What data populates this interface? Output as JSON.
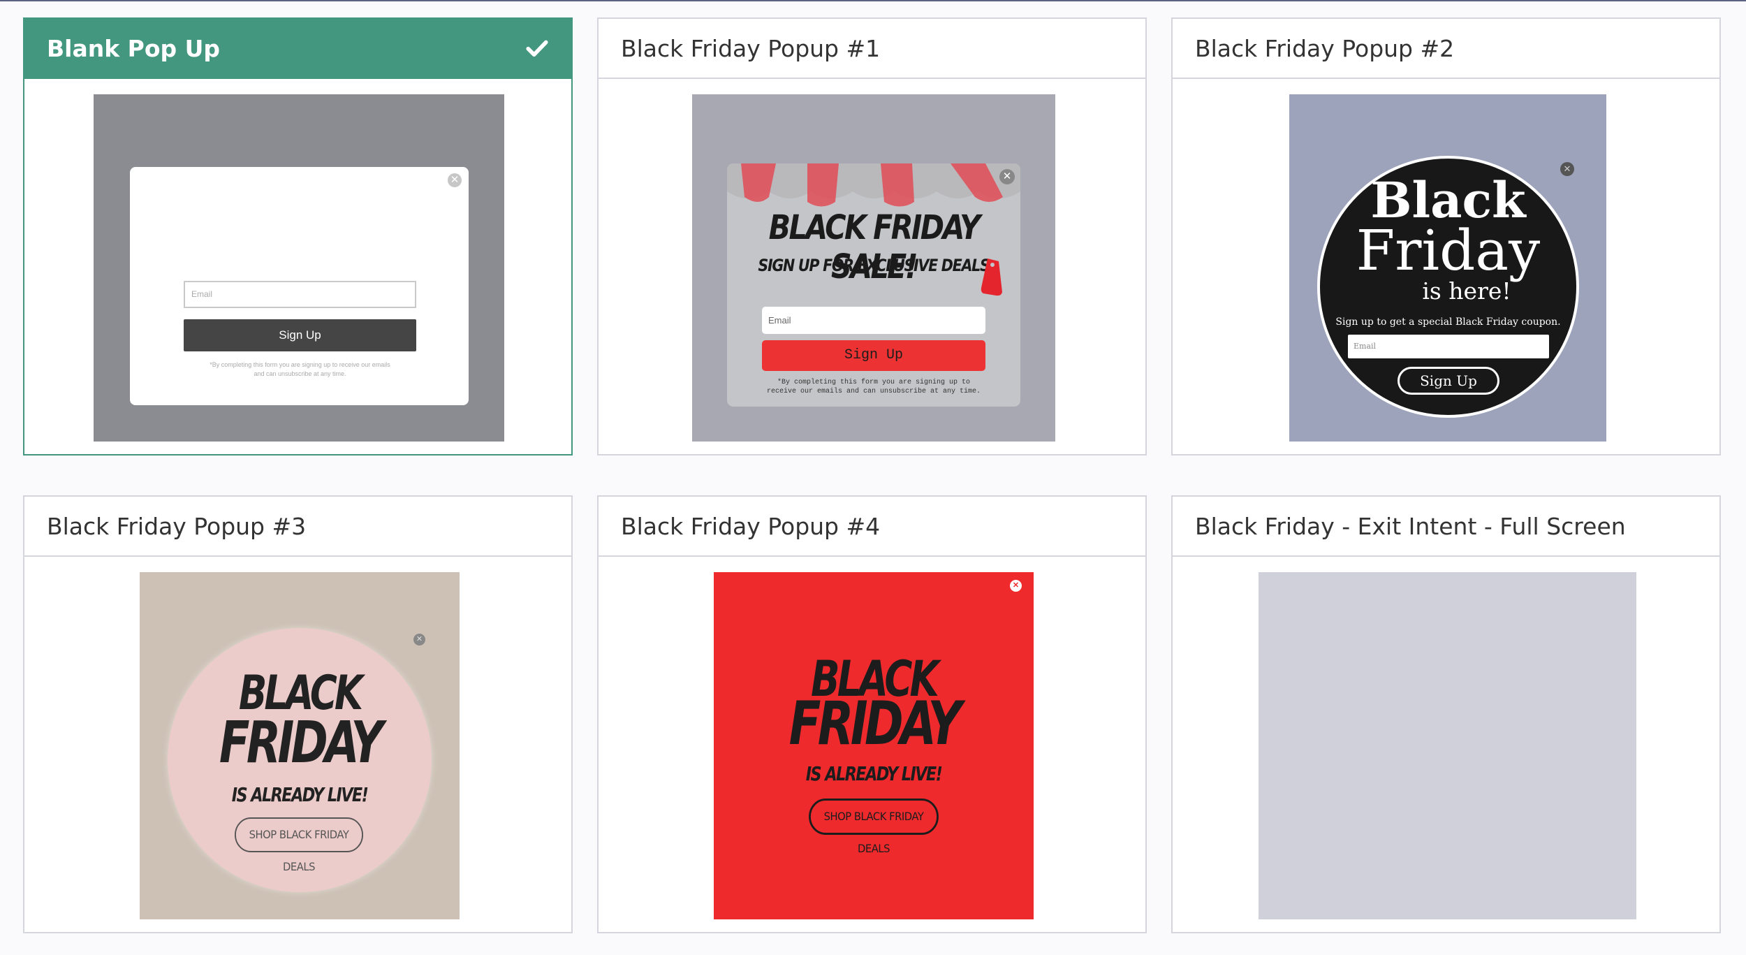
{
  "templates": [
    {
      "title": "Blank Pop Up",
      "selected": true,
      "preview": {
        "email_placeholder": "Email",
        "button": "Sign Up",
        "legal_1": "*By completing this form you are signing up to receive our emails",
        "legal_2": "and can unsubscribe at any time."
      }
    },
    {
      "title": "Black Friday Popup #1",
      "selected": false,
      "preview": {
        "headline": "BLACK FRIDAY SALE!",
        "subhead": "SIGN UP FOR EXCLUSIVE DEALS",
        "email_placeholder": "Email",
        "button": "Sign Up",
        "legal_1": "*By completing this form you are signing up to",
        "legal_2": "receive our emails and can unsubscribe at any time."
      }
    },
    {
      "title": "Black Friday Popup #2",
      "selected": false,
      "preview": {
        "line1": "Black",
        "line2": "Friday",
        "line3": "is here!",
        "subhead": "Sign up to get a special Black Friday coupon.",
        "email_placeholder": "Email",
        "button": "Sign Up"
      }
    },
    {
      "title": "Black Friday Popup #3",
      "selected": false,
      "preview": {
        "line1": "BLACK",
        "line2": "FRIDAY",
        "line3": "IS ALREADY LIVE!",
        "button": "SHOP BLACK FRIDAY DEALS"
      }
    },
    {
      "title": "Black Friday Popup #4",
      "selected": false,
      "preview": {
        "line1": "BLACK",
        "line2": "FRIDAY",
        "line3": "IS ALREADY LIVE!",
        "button": "SHOP BLACK FRIDAY DEALS"
      }
    },
    {
      "title": "Black Friday - Exit Intent - Full Screen",
      "selected": false,
      "preview": {}
    }
  ],
  "colors": {
    "selected_accent": "#43977f",
    "card_border": "#d4d5dd",
    "page_background": "#fafafc"
  },
  "icons": {
    "selected": "checkmark-icon",
    "popup_close": "close-icon"
  }
}
